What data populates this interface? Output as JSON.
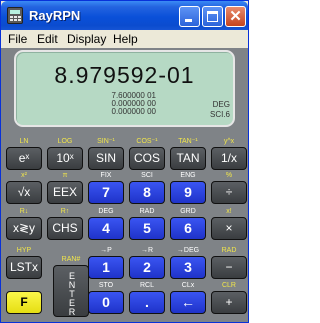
{
  "window": {
    "title": "RayRPN",
    "minimize": "",
    "maximize": "",
    "close": "✕"
  },
  "menu": [
    "File",
    "Edit",
    "Display",
    "Help"
  ],
  "display": {
    "main": "8.979592-01",
    "stack": [
      "7.600000 01",
      "0.000000 00",
      "0.000000 00"
    ],
    "status": [
      "DEG",
      "SCI.6"
    ]
  },
  "keys": [
    {
      "shift": [
        "LN"
      ],
      "cap": "eˣ",
      "type": "gray"
    },
    {
      "shift": [
        "LOG"
      ],
      "cap": "10ˣ",
      "type": "gray"
    },
    {
      "shift": [
        "SIN⁻¹"
      ],
      "cap": "SIN",
      "type": "gray"
    },
    {
      "shift": [
        "COS⁻¹"
      ],
      "cap": "COS",
      "type": "gray"
    },
    {
      "shift": [
        "TAN⁻¹"
      ],
      "cap": "TAN",
      "type": "gray"
    },
    {
      "shift": [
        "y^x"
      ],
      "cap": "1/x",
      "type": "gray"
    },
    {
      "shift": [
        "x²"
      ],
      "cap": "√x",
      "type": "gray"
    },
    {
      "shift": [
        "π"
      ],
      "cap": "EEX",
      "type": "gray"
    },
    {
      "shift": [
        "FIX"
      ],
      "cap": "7",
      "type": "blue"
    },
    {
      "shift": [
        "SCI"
      ],
      "cap": "8",
      "type": "blue"
    },
    {
      "shift": [
        "ENG"
      ],
      "cap": "9",
      "type": "blue"
    },
    {
      "shift": [
        "%"
      ],
      "cap": "÷",
      "type": "gray"
    },
    {
      "shift": [
        "R↓"
      ],
      "cap": "x≷y",
      "type": "gray"
    },
    {
      "shift": [
        "R↑"
      ],
      "cap": "CHS",
      "type": "gray"
    },
    {
      "shift": [
        "DEG"
      ],
      "cap": "4",
      "type": "blue"
    },
    {
      "shift": [
        "RAD"
      ],
      "cap": "5",
      "type": "blue"
    },
    {
      "shift": [
        "GRD"
      ],
      "cap": "6",
      "type": "blue"
    },
    {
      "shift": [
        "x!"
      ],
      "cap": "×",
      "type": "gray"
    },
    {
      "shift": [
        "HYP"
      ],
      "cap": "LSTx",
      "type": "gray"
    },
    {
      "shift": [
        "→P"
      ],
      "cap": "1",
      "type": "blue"
    },
    {
      "shift": [
        "→R"
      ],
      "cap": "2",
      "type": "blue"
    },
    {
      "shift": [
        "→DEG"
      ],
      "cap": "3",
      "type": "blue"
    },
    {
      "shift": [
        "RAD"
      ],
      "cap": "−",
      "type": "gray"
    },
    {
      "shift": [
        ""
      ],
      "cap": "F",
      "type": "yellow"
    },
    {
      "shift": [
        "STO"
      ],
      "cap": "0",
      "type": "blue"
    },
    {
      "shift": [
        "RCL"
      ],
      "cap": ".",
      "type": "blue"
    },
    {
      "shift": [
        "CLx"
      ],
      "cap": "←",
      "type": "blue"
    },
    {
      "shift": [
        "CLR"
      ],
      "cap": "+",
      "type": "gray"
    }
  ],
  "enter": {
    "shift": "RAN#",
    "label": [
      "E",
      "N",
      "T",
      "E",
      "R"
    ]
  },
  "colors": {
    "title": "#0a50d9",
    "display": "#b6d9c4",
    "body": "#7f8387",
    "blue_key": "#2a42e0",
    "gray_key": "#4a4d50",
    "f_key": "#f5f035",
    "shift_text": "#f1e64a"
  }
}
